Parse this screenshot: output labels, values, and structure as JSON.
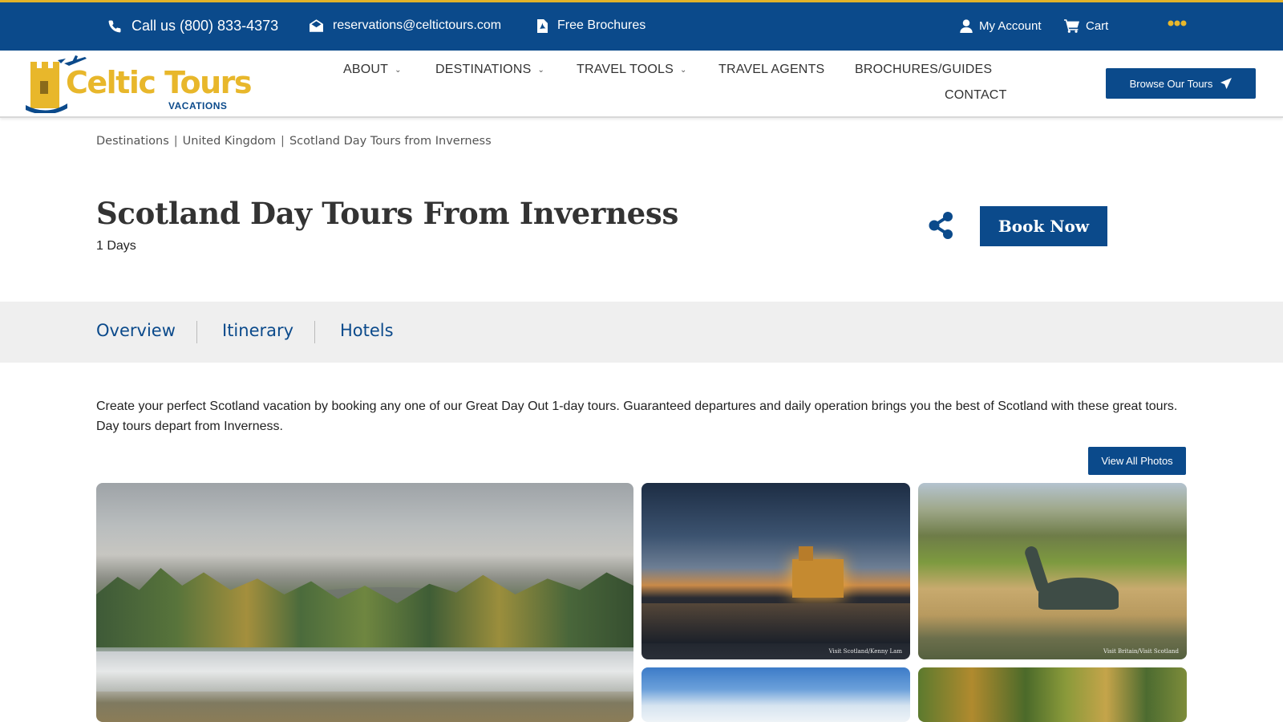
{
  "topbar": {
    "phone": "Call us (800) 833-4373",
    "email": "reservations@celtictours.com",
    "brochures": "Free Brochures",
    "account": "My Account",
    "cart": "Cart"
  },
  "logo": {
    "name": "Celtic Tours",
    "sub": "VACATIONS"
  },
  "nav": {
    "about": "ABOUT",
    "destinations": "DESTINATIONS",
    "travel_tools": "TRAVEL TOOLS",
    "travel_agents": "TRAVEL AGENTS",
    "brochures": "BROCHURES/GUIDES",
    "contact": "CONTACT",
    "browse_button": "Browse Our Tours"
  },
  "breadcrumb": [
    "Destinations",
    "United Kingdom",
    "Scotland Day Tours from Inverness"
  ],
  "page": {
    "title": "Scotland Day Tours From Inverness",
    "duration": "1 Days",
    "book_button": "Book Now"
  },
  "tabs": [
    "Overview",
    "Itinerary",
    "Hotels"
  ],
  "description": "Create your perfect Scotland vacation by booking any one of our Great Day Out 1-day tours. Guaranteed departures and daily operation brings you the best of Scotland with these great tours. Day tours depart from Inverness.",
  "photos": {
    "view_all": "View All Photos",
    "credit_2": "Visit Scotland/Kenny Lam",
    "credit_3": "Visit Britain/Visit Scotland"
  },
  "colors": {
    "brand_blue": "#0b4a8b",
    "brand_gold": "#e8b72b"
  }
}
